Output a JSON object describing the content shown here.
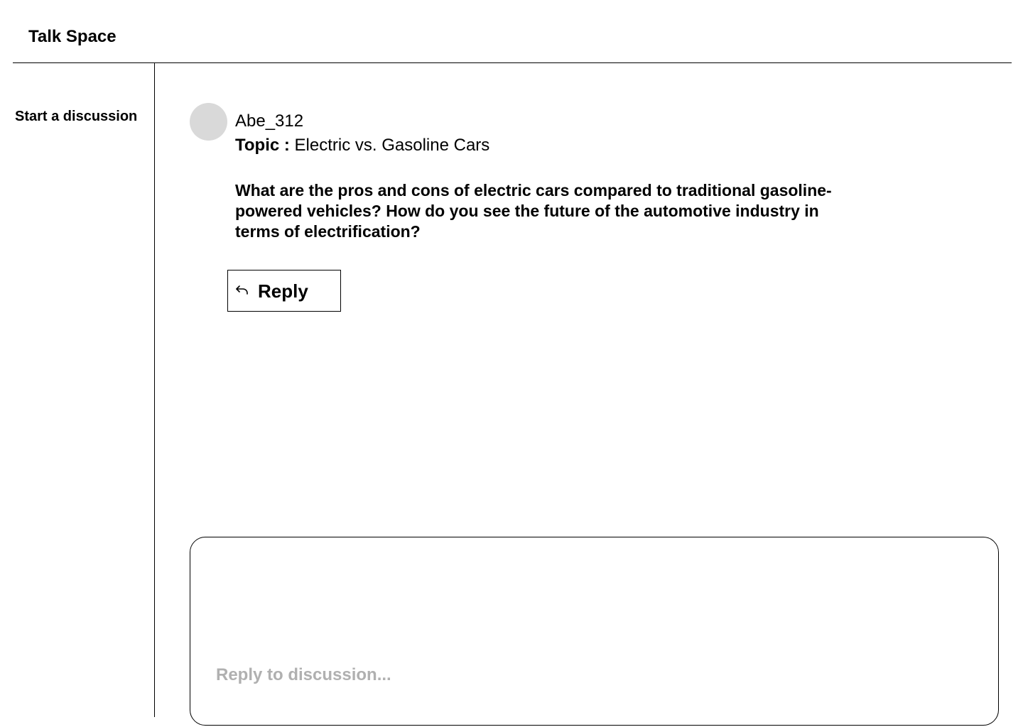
{
  "header": {
    "title": "Talk Space"
  },
  "sidebar": {
    "items": [
      {
        "label": "Start a discussion"
      }
    ]
  },
  "post": {
    "author": "Abe_312",
    "topic_label": "Topic :",
    "topic_value": "Electric vs. Gasoline Cars",
    "body": "What are the pros and cons of electric cars compared to traditional gasoline-powered vehicles? How do you see the future of the automotive industry in terms of electrification?",
    "reply_button_label": "Reply",
    "reply_icon": "reply-arrow-icon"
  },
  "composer": {
    "value": "",
    "placeholder": "Reply to discussion..."
  },
  "colors": {
    "avatar": "#d9d9d9",
    "placeholder": "#b0b0b0",
    "border": "#000000"
  }
}
